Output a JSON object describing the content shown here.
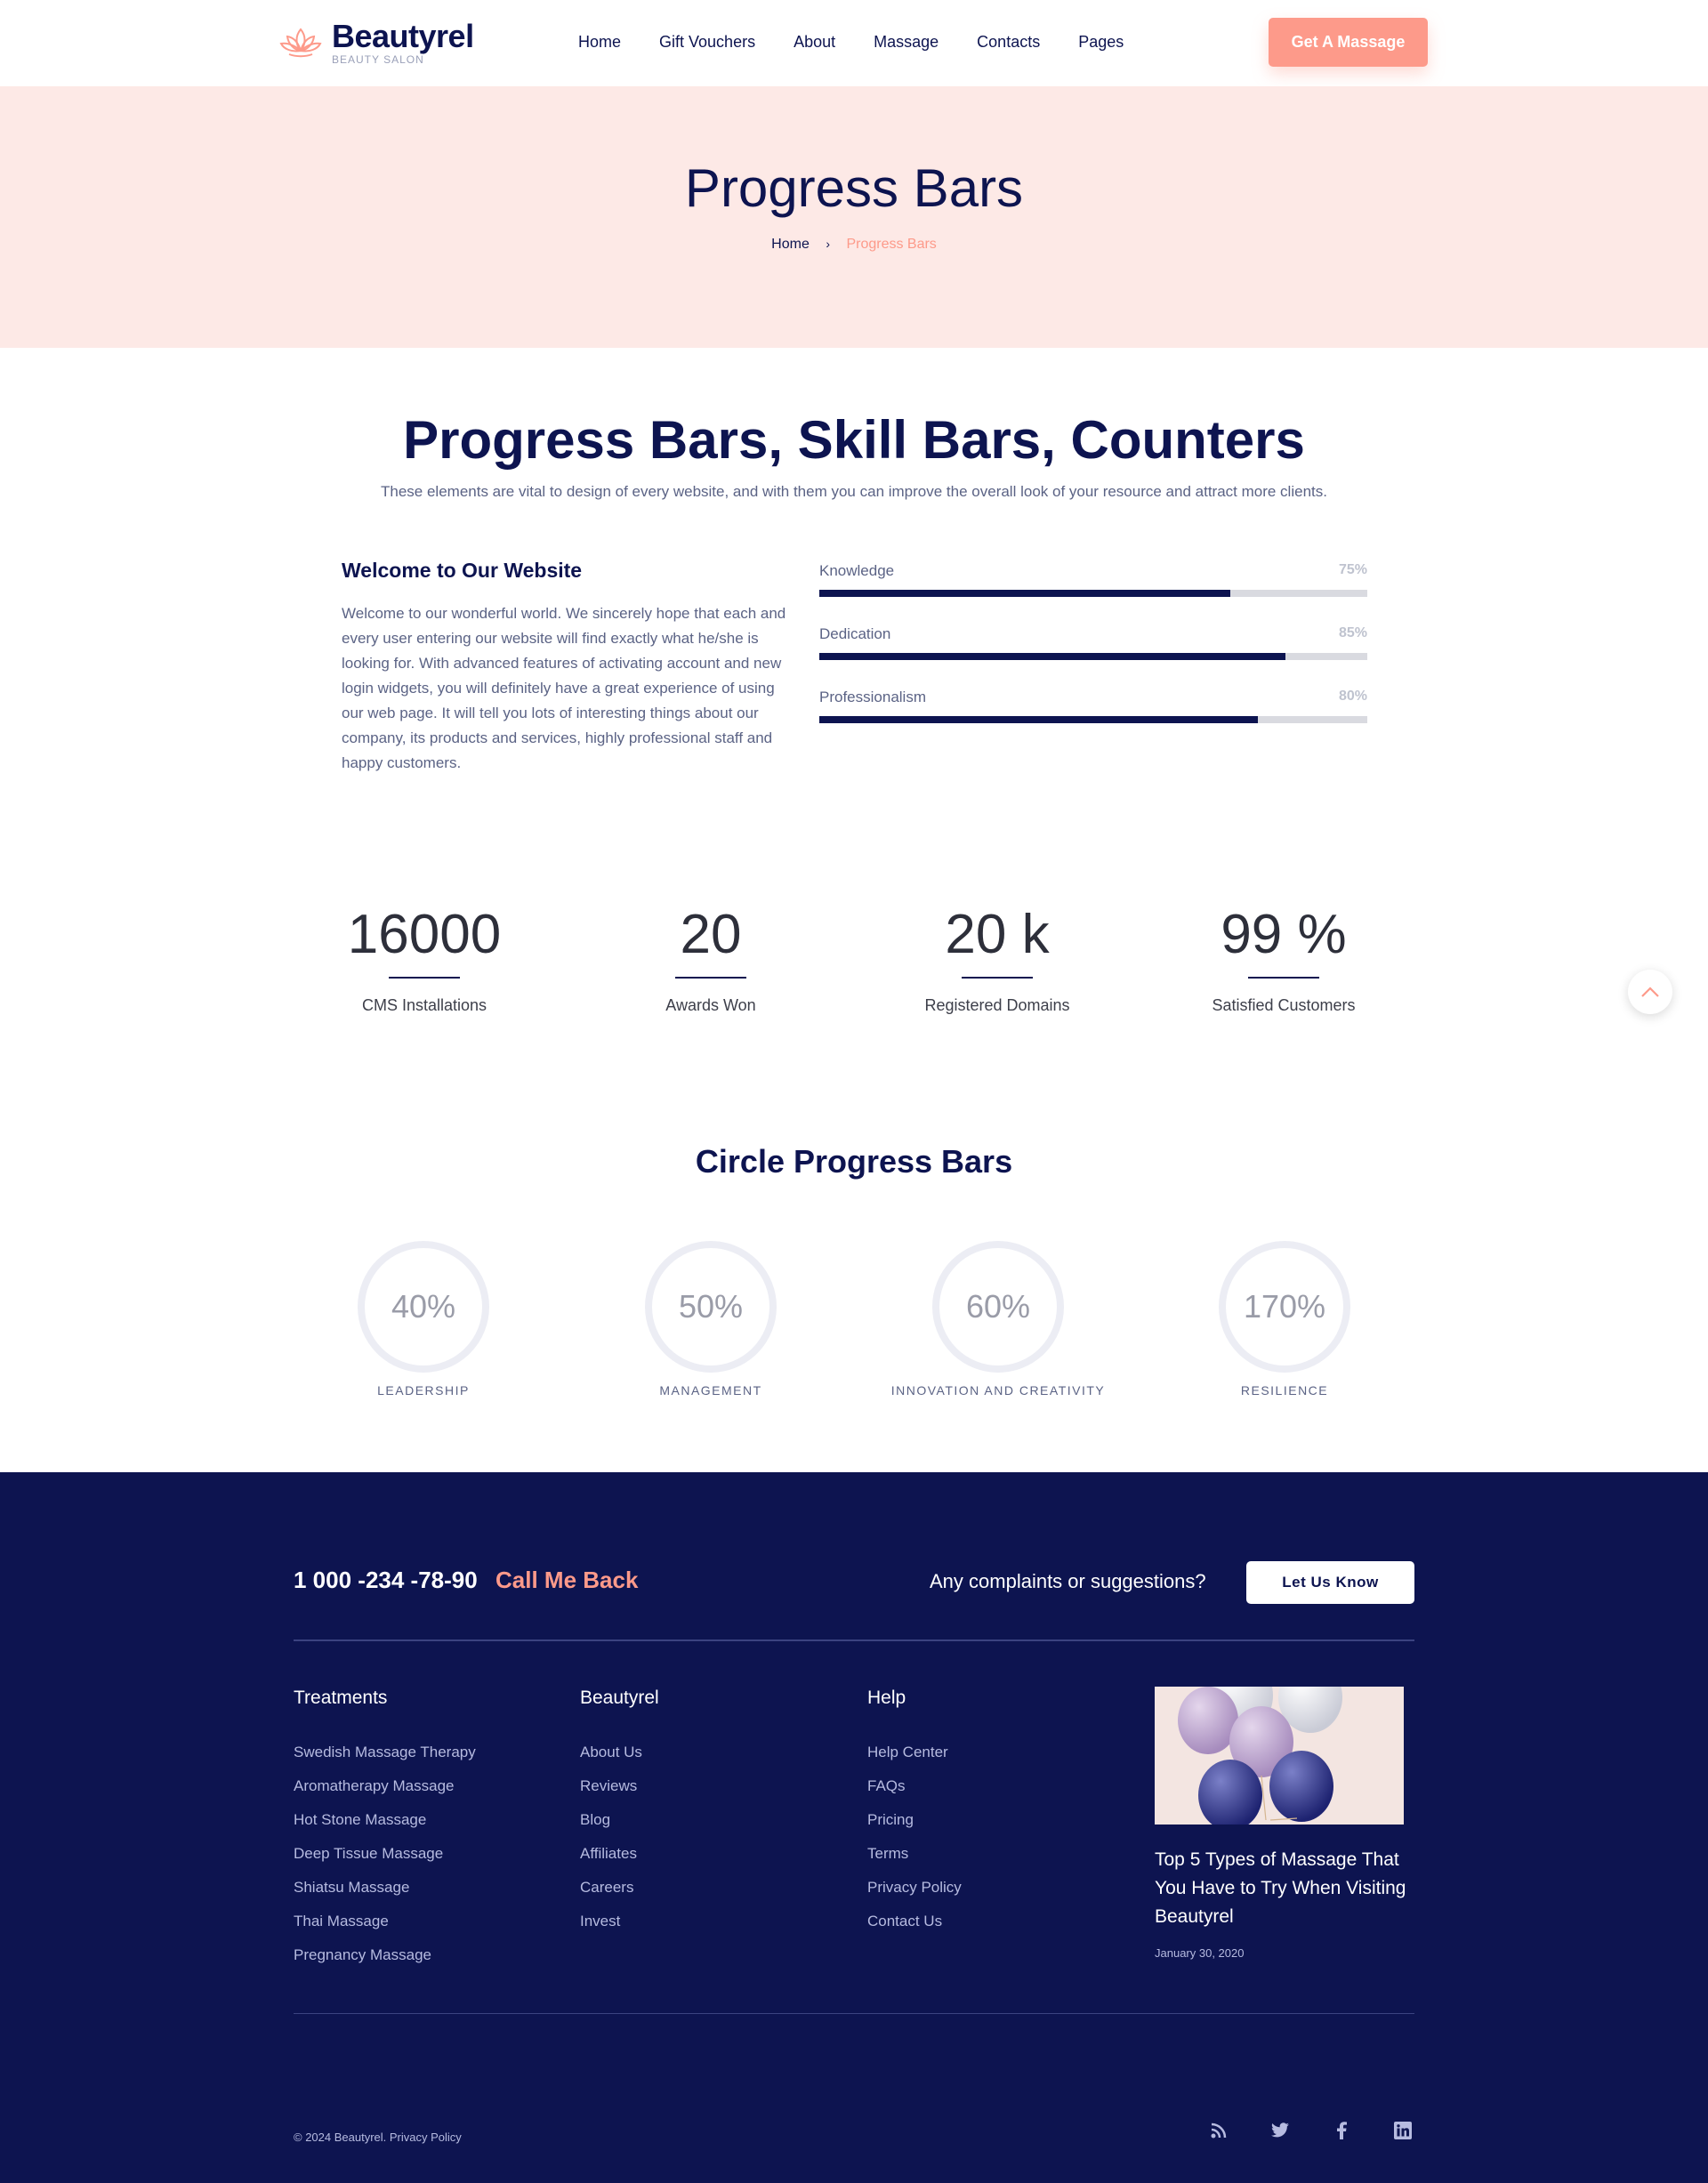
{
  "header": {
    "logo_name": "Beautyrel",
    "logo_tag": "BEAUTY SALON",
    "nav": [
      "Home",
      "Gift Vouchers",
      "About",
      "Massage",
      "Contacts",
      "Pages"
    ],
    "cta": "Get A Massage"
  },
  "hero": {
    "title": "Progress Bars",
    "crumb_home": "Home",
    "crumb_sep": "›",
    "crumb_current": "Progress Bars"
  },
  "section": {
    "title": "Progress Bars, Skill Bars, Counters",
    "subtitle": "These elements are vital to design of every website, and with them you can improve the overall look of your resource and attract more clients.",
    "welcome_heading": "Welcome to Our Website",
    "welcome_text": "Welcome to our wonderful world. We sincerely hope that each and every user entering our website will find exactly what he/she is looking for. With advanced features of activating account and new login widgets, you will definitely have a great experience of using our web page. It will tell you lots of interesting things about our company, its products and services, highly professional staff and happy customers."
  },
  "skills": [
    {
      "label": "Knowledge",
      "value": 75,
      "value_text": "75%"
    },
    {
      "label": "Dedication",
      "value": 85,
      "value_text": "85%"
    },
    {
      "label": "Professionalism",
      "value": 80,
      "value_text": "80%"
    }
  ],
  "counters": [
    {
      "number": "16000",
      "label": "CMS Installations"
    },
    {
      "number": "20",
      "label": "Awards Won"
    },
    {
      "number": "20 k",
      "label": "Registered Domains"
    },
    {
      "number": "99 %",
      "label": "Satisfied Customers"
    }
  ],
  "circles_title": "Circle Progress Bars",
  "circles": [
    {
      "value": "40%",
      "label": "LEADERSHIP"
    },
    {
      "value": "50%",
      "label": "MANAGEMENT"
    },
    {
      "value": "60%",
      "label": "INNOVATION AND CREATIVITY"
    },
    {
      "value": "170%",
      "label": "RESILIENCE"
    }
  ],
  "footer": {
    "phone": "1 000 -234 -78-90",
    "callback": "Call Me Back",
    "complaints": "Any complaints or suggestions?",
    "let_us_know": "Let Us Know",
    "columns": [
      {
        "title": "Treatments",
        "links": [
          "Swedish Massage Therapy",
          "Aromatherapy Massage",
          "Hot Stone Massage",
          "Deep Tissue Massage",
          "Shiatsu Massage",
          "Thai Massage",
          "Pregnancy Massage"
        ]
      },
      {
        "title": "Beautyrel",
        "links": [
          "About Us",
          "Reviews",
          "Blog",
          "Affiliates",
          "Careers",
          "Invest"
        ]
      },
      {
        "title": "Help",
        "links": [
          "Help Center",
          "FAQs",
          "Pricing",
          "Terms",
          "Privacy Policy",
          "Contact Us"
        ]
      }
    ],
    "post_title": "Top 5 Types of Massage That You Have to Try When Visiting Beautyrel",
    "post_date": "January 30, 2020",
    "copyright": "© 2024 Beautyrel. Privacy Policy",
    "social_icons": [
      "rss-icon",
      "twitter-icon",
      "facebook-icon",
      "linkedin-icon"
    ]
  },
  "colors": {
    "navy": "#0d1450",
    "coral": "#fd9a8a",
    "hero_bg": "#fde9e6"
  }
}
